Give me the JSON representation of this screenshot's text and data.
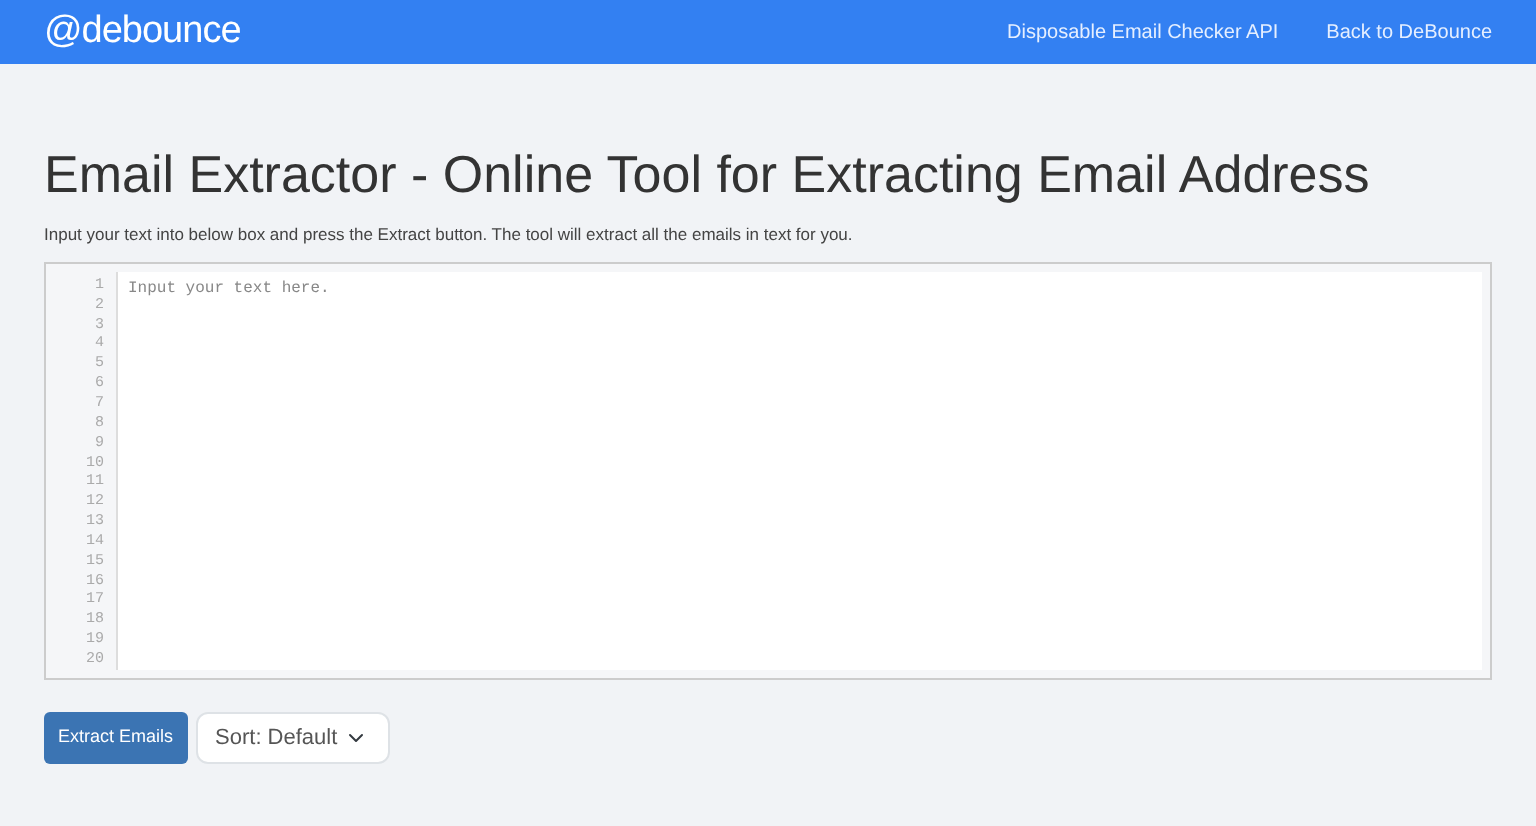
{
  "navbar": {
    "logo": "@debounce",
    "links": [
      "Disposable Email Checker API",
      "Back to DeBounce"
    ]
  },
  "title": "Email Extractor - Online Tool for Extracting Email Address",
  "description": "Input your text into below box and press the Extract button. The tool will extract all the emails in text for you.",
  "editor": {
    "line_numbers": [
      "1",
      "2",
      "3",
      "4",
      "5",
      "6",
      "7",
      "8",
      "9",
      "10",
      "11",
      "12",
      "13",
      "14",
      "15",
      "16",
      "17",
      "18",
      "19",
      "20"
    ],
    "placeholder": "Input your text here."
  },
  "extract_button": "Extract Emails",
  "sort_select": {
    "value": "Sort: Default"
  }
}
